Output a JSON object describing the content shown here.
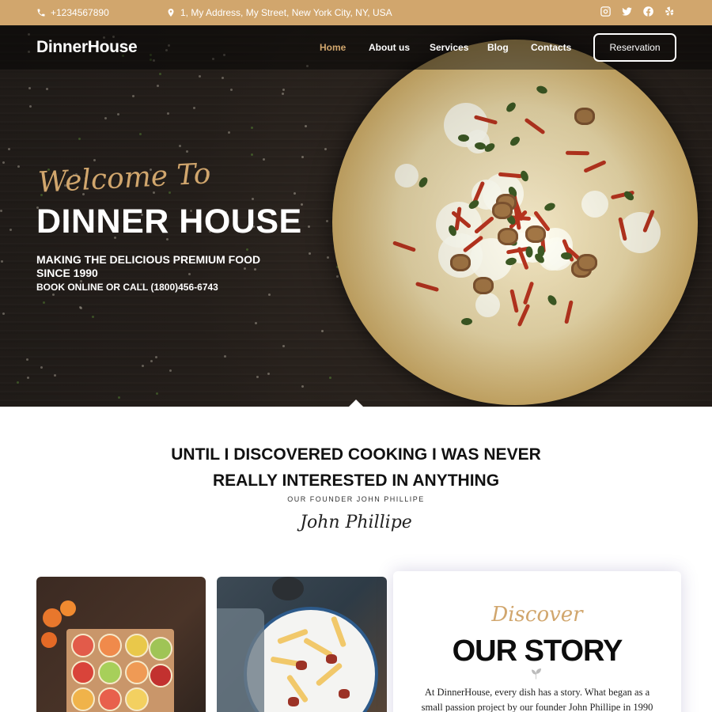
{
  "topbar": {
    "phone": "+1234567890",
    "address": "1, My Address, My Street, New York City, NY, USA",
    "socials": [
      "instagram-icon",
      "twitter-icon",
      "facebook-icon",
      "yelp-icon"
    ]
  },
  "nav": {
    "logo": "DinnerHouse",
    "items": [
      {
        "label": "Home",
        "active": true
      },
      {
        "label": "About us"
      },
      {
        "label": "Services"
      },
      {
        "label": "Blog"
      },
      {
        "label": "Contacts"
      }
    ],
    "reservation": "Reservation"
  },
  "hero": {
    "welcome": "Welcome To",
    "title": "DINNER HOUSE",
    "tagline": "MAKING THE DELICIOUS PREMIUM FOOD SINCE 1990",
    "book": "BOOK ONLINE OR CALL (1800)456-6743"
  },
  "quote": {
    "line1": "UNTIL I DISCOVERED COOKING I WAS NEVER",
    "line2": "REALLY INTERESTED IN ANYTHING",
    "founder": "OUR FOUNDER JOHN PHILLIPE",
    "signature": "John Phillipe"
  },
  "story": {
    "script": "Discover",
    "title": "OUR STORY",
    "text": "At DinnerHouse, every dish has a story. What began as a small passion project by our founder John Phillipe in 1990"
  },
  "colors": {
    "accent": "#d1a66d",
    "dark": "#2a2420"
  }
}
